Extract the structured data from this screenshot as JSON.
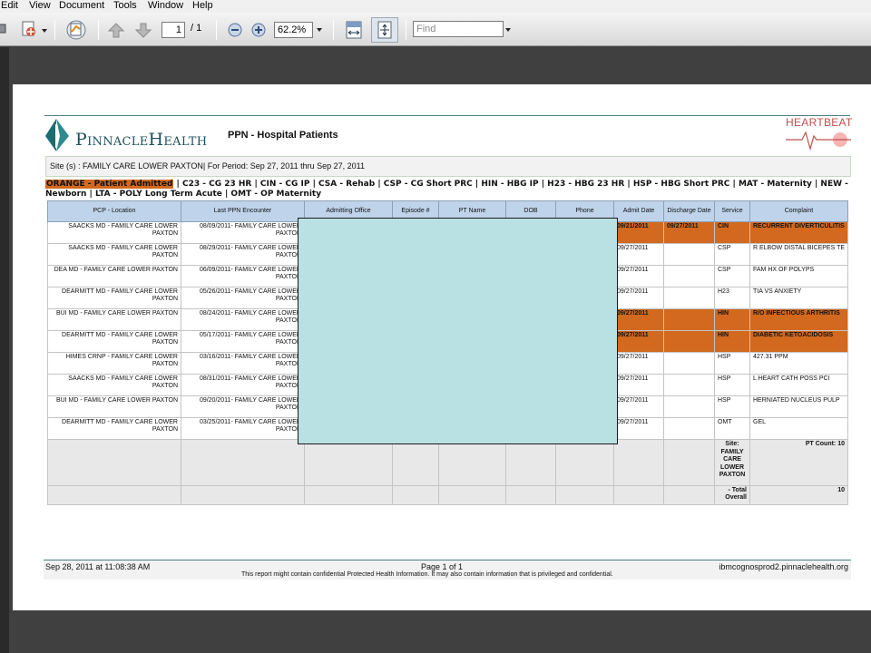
{
  "menu": [
    "Edit",
    "View",
    "Document",
    "Tools",
    "Window",
    "Help"
  ],
  "toolbar": {
    "page_current": "1",
    "page_total": "/  1",
    "zoom": "62.2%",
    "find_placeholder": "Find"
  },
  "report": {
    "logo": "PinnacleHealth",
    "title": "PPN - Hospital Patients",
    "heartbeat": "HEARTBEAT",
    "site_line": "Site (s) : FAMILY CARE LOWER PAXTON| For Period: Sep 27, 2011 thru Sep 27, 2011",
    "legend_orange": "ORANGE - Patient Admitted",
    "legend_rest": " | C23 - CG 23 HR | CIN - CG IP | CSA - Rehab | CSP - CG Short PRC | HIN - HBG IP | H23 - HBG 23 HR | HSP - HBG Short PRC | MAT - Maternity | NEW - Newborn | LTA - POLY Long Term Acute | OMT - OP Maternity"
  },
  "table": {
    "headers": [
      "PCP - Location",
      "Last PPN Encounter",
      "Admitting Office",
      "Episode #",
      "PT Name",
      "DOB",
      "Phone",
      "Admit Date",
      "Discharge Date",
      "Service",
      "Complaint"
    ],
    "rows": [
      {
        "pcp": "SAACKS MD - FAMILY CARE LOWER PAXTON",
        "enc": "08/09/2011- FAMILY CARE LOWER PAXTON",
        "admit": "09/21/2011",
        "dis": "09/27/2011",
        "svc": "CIN",
        "comp": "RECURRENT DIVERTICULITIS",
        "hl": true
      },
      {
        "pcp": "SAACKS MD - FAMILY CARE LOWER PAXTON",
        "enc": "08/29/2011- FAMILY CARE LOWER PAXTON",
        "admit": "09/27/2011",
        "dis": "",
        "svc": "CSP",
        "comp": "R ELBOW DISTAL BICEPES TE",
        "hl": false
      },
      {
        "pcp": "DEA MD - FAMILY CARE LOWER PAXTON",
        "enc": "06/09/2011- FAMILY CARE LOWER PAXTON",
        "admit": "09/27/2011",
        "dis": "",
        "svc": "CSP",
        "comp": "FAM HX OF POLYPS",
        "hl": false
      },
      {
        "pcp": "DEARMITT MD - FAMILY CARE LOWER PAXTON",
        "enc": "05/26/2011- FAMILY CARE LOWER PAXTON",
        "admit": "09/27/2011",
        "dis": "",
        "svc": "H23",
        "comp": "TIA VS ANXIETY",
        "hl": false
      },
      {
        "pcp": "BUI MD - FAMILY CARE LOWER PAXTON",
        "enc": "08/24/2011- FAMILY CARE LOWER PAXTON",
        "admit": "09/27/2011",
        "dis": "",
        "svc": "HIN",
        "comp": "R/O INFECTIOUS ARTHRITIS",
        "hl": true
      },
      {
        "pcp": "DEARMITT MD - FAMILY CARE LOWER PAXTON",
        "enc": "05/17/2011- FAMILY CARE LOWER PAXTON",
        "admit": "09/27/2011",
        "dis": "",
        "svc": "HIN",
        "comp": "DIABETIC KETOACIDOSIS",
        "hl": true
      },
      {
        "pcp": "HIMES CRNP - FAMILY CARE LOWER PAXTON",
        "enc": "03/16/2011- FAMILY CARE LOWER PAXTON",
        "admit": "09/27/2011",
        "dis": "",
        "svc": "HSP",
        "comp": "427.31 PPM",
        "hl": false
      },
      {
        "pcp": "SAACKS MD - FAMILY CARE LOWER PAXTON",
        "enc": "08/31/2011- FAMILY CARE LOWER PAXTON",
        "admit": "09/27/2011",
        "dis": "",
        "svc": "HSP",
        "comp": "L HEART CATH POSS PCI",
        "hl": false
      },
      {
        "pcp": "BUI MD - FAMILY CARE LOWER PAXTON",
        "enc": "09/20/2011- FAMILY CARE LOWER PAXTON",
        "admit": "09/27/2011",
        "dis": "",
        "svc": "HSP",
        "comp": "HERNIATED NUCLEUS PULP",
        "hl": false
      },
      {
        "pcp": "DEARMITT MD - FAMILY CARE LOWER PAXTON",
        "enc": "03/25/2011- FAMILY CARE LOWER PAXTON",
        "admit": "09/27/2011",
        "dis": "",
        "svc": "OMT",
        "comp": "GEL",
        "hl": false
      }
    ],
    "summary_site_label": "Site: FAMILY CARE LOWER PAXTON",
    "summary_site_count": "PT Count:  10",
    "summary_total_label": "- Total Overall",
    "summary_total_count": "10"
  },
  "footer": {
    "date": "Sep 28, 2011 at 11:08:38 AM",
    "page": "Page 1 of 1",
    "host": "ibmcognosprod2.pinnaclehealth.org",
    "note": "This report might contain confidential Protected Health Information. It may also contain information that is privileged and confidential."
  },
  "colors": {
    "admitted": "#d2691e",
    "header_bg": "#bfd4ea",
    "redaction": "#b9e0e3"
  }
}
